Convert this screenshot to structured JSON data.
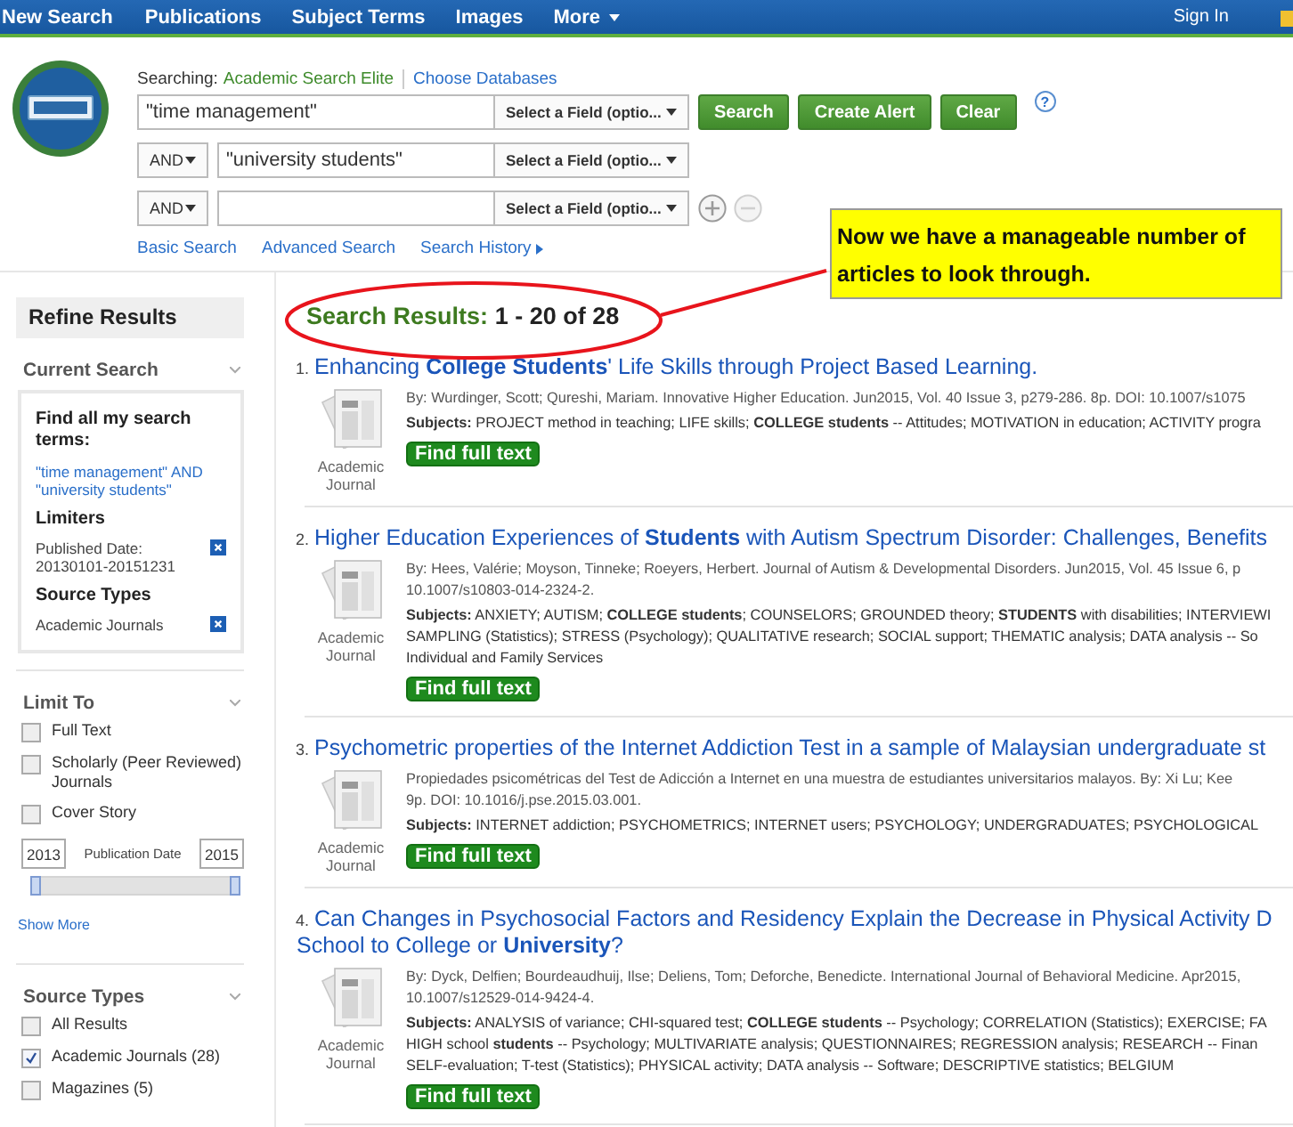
{
  "nav": {
    "items": [
      {
        "label": "New Search",
        "kind": "link"
      },
      {
        "label": "Publications",
        "kind": "link"
      },
      {
        "label": "Subject Terms",
        "kind": "link"
      },
      {
        "label": "Images",
        "kind": "link"
      },
      {
        "label": "More",
        "kind": "menu"
      }
    ],
    "sign_in": "Sign In"
  },
  "search": {
    "searching_label": "Searching:",
    "database": "Academic Search Elite",
    "choose_link": "Choose Databases",
    "rows": [
      {
        "value": "\"time management\"",
        "field": "Select a Field (optio..."
      },
      {
        "operator": "AND",
        "value": "\"university students\"",
        "field": "Select a Field (optio..."
      },
      {
        "operator": "AND",
        "field": "Select a Field (optio...",
        "add_disabled": false,
        "remove_disabled": true
      }
    ],
    "buttons": [
      "Search",
      "Create Alert",
      "Clear"
    ],
    "help": "?",
    "links": [
      "Basic Search",
      "Advanced Search",
      "Search History"
    ]
  },
  "callout": "Now we have a manageable number of articles to look through.",
  "sidebar": {
    "title": "Refine Results",
    "current_search": {
      "heading": "Current Search",
      "terms_label": "Find all my search terms:",
      "query": "\"time management\" AND \"university students\"",
      "limiters_heading": "Limiters",
      "limiters": [
        "Published Date: 20130101-20151231"
      ],
      "source_types_heading": "Source Types",
      "source_types": [
        "Academic Journals"
      ]
    },
    "limit_to": {
      "heading": "Limit To",
      "options": [
        {
          "label": "Full Text",
          "checked": false
        },
        {
          "label": "Scholarly (Peer Reviewed) Journals",
          "checked": false
        },
        {
          "label": "Cover Story",
          "checked": false
        }
      ],
      "date_from": "2013",
      "date_label": "Publication Date",
      "date_to": "2015",
      "slider": {
        "level": 1
      },
      "show_more": "Show More"
    },
    "source_types": {
      "heading": "Source Types",
      "options": [
        {
          "label": "All Results",
          "checked": false
        },
        {
          "label": "Academic Journals (28)",
          "checked": true
        },
        {
          "label": "Magazines (5)",
          "checked": false
        }
      ]
    }
  },
  "results": {
    "heading": "Search Results:",
    "count": "1 - 20 of 28",
    "items": [
      {
        "number": "1.",
        "title": [
          "Enhancing **College Students**' Life Skills through Project Based Learning."
        ],
        "type": "Academic Journal",
        "meta": [
          "By: Wurdinger, Scott; Qureshi, Mariam. Innovative Higher Education. Jun2015, Vol. 40 Issue 3, p279-286. 8p. DOI: 10.1007/s1075"
        ],
        "subjects": [
          "**Subjects:** PROJECT method in teaching; LIFE skills; **COLLEGE students** -- Attitudes; MOTIVATION in education; ACTIVITY progra"
        ],
        "button": "Find full text"
      },
      {
        "number": "2.",
        "title": [
          "Higher Education Experiences of **Students** with Autism Spectrum Disorder: Challenges, Benefits"
        ],
        "type": "Academic Journal",
        "meta": [
          "By: Hees, Valérie; Moyson, Tinneke; Roeyers, Herbert. Journal of Autism & Developmental Disorders. Jun2015, Vol. 45 Issue 6, p",
          "10.1007/s10803-014-2324-2."
        ],
        "subjects": [
          "**Subjects:** ANXIETY; AUTISM; **COLLEGE students**; COUNSELORS; GROUNDED theory; **STUDENTS** with disabilities; INTERVIEWI",
          "SAMPLING (Statistics); STRESS (Psychology); QUALITATIVE research; SOCIAL support; THEMATIC analysis; DATA analysis -- So",
          "Individual and Family Services"
        ],
        "button": "Find full text"
      },
      {
        "number": "3.",
        "title": [
          "Psychometric properties of the Internet Addiction Test in a sample of Malaysian undergraduate st"
        ],
        "type": "Academic Journal",
        "meta": [
          "Propiedades psicométricas del Test de Adicción a Internet en una muestra de estudiantes universitarios malayos. By: Xi Lu; Kee",
          "9p. DOI: 10.1016/j.pse.2015.03.001."
        ],
        "subjects": [
          "**Subjects:** INTERNET addiction; PSYCHOMETRICS; INTERNET users; PSYCHOLOGY; UNDERGRADUATES; PSYCHOLOGICAL"
        ],
        "button": "Find full text"
      },
      {
        "number": "4.",
        "title": [
          "Can Changes in Psychosocial Factors and Residency Explain the Decrease in Physical Activity D",
          "School to College or **University**?"
        ],
        "type": "Academic Journal",
        "meta": [
          "By: Dyck, Delfien; Bourdeaudhuij, Ilse; Deliens, Tom; Deforche, Benedicte. International Journal of Behavioral Medicine. Apr2015,",
          "10.1007/s12529-014-9424-4."
        ],
        "subjects": [
          "**Subjects:** ANALYSIS of variance; CHI-squared test; **COLLEGE students** -- Psychology; CORRELATION (Statistics); EXERCISE; FA",
          "HIGH school **students** -- Psychology; MULTIVARIATE analysis; QUESTIONNAIRES; REGRESSION analysis; RESEARCH -- Finan",
          "SELF-evaluation; T-test (Statistics); PHYSICAL activity; DATA analysis -- Software; DESCRIPTIVE statistics; BELGIUM"
        ],
        "button": "Find full text"
      }
    ]
  }
}
